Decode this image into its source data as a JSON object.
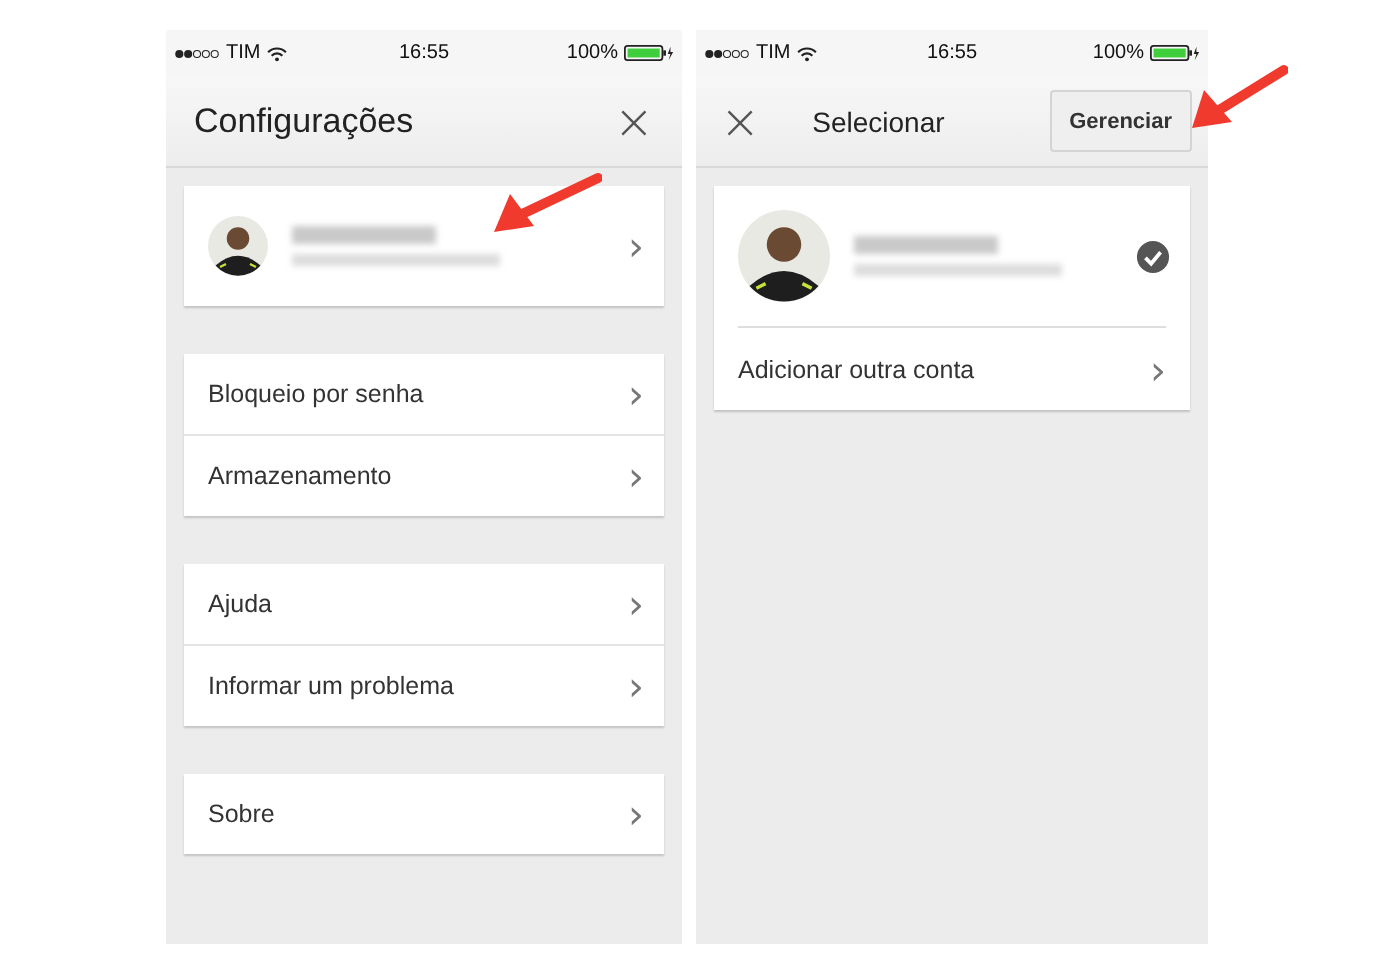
{
  "screens": [
    {
      "status_bar": {
        "carrier": "TIM",
        "time": "16:55",
        "battery": "100%"
      },
      "header": {
        "kind": "title",
        "title": "Configurações",
        "close": "×"
      },
      "groups": [
        [
          {
            "kind": "account",
            "chevron": "›"
          }
        ],
        [
          {
            "kind": "item",
            "label": "Bloqueio por senha",
            "chevron": "›"
          },
          {
            "kind": "item",
            "label": "Armazenamento",
            "chevron": "›"
          }
        ],
        [
          {
            "kind": "item",
            "label": "Ajuda",
            "chevron": "›"
          },
          {
            "kind": "item",
            "label": "Informar um problema",
            "chevron": "›"
          }
        ],
        [
          {
            "kind": "item",
            "label": "Sobre",
            "chevron": "›"
          }
        ]
      ]
    },
    {
      "status_bar": {
        "carrier": "TIM",
        "time": "16:55",
        "battery": "100%"
      },
      "header": {
        "kind": "center",
        "title": "Selecionar",
        "close": "×",
        "action": "Gerenciar"
      },
      "groups": [
        [
          {
            "kind": "account",
            "checked": true
          },
          {
            "kind": "item",
            "label": "Adicionar outra conta",
            "chevron": "›"
          }
        ]
      ]
    }
  ]
}
